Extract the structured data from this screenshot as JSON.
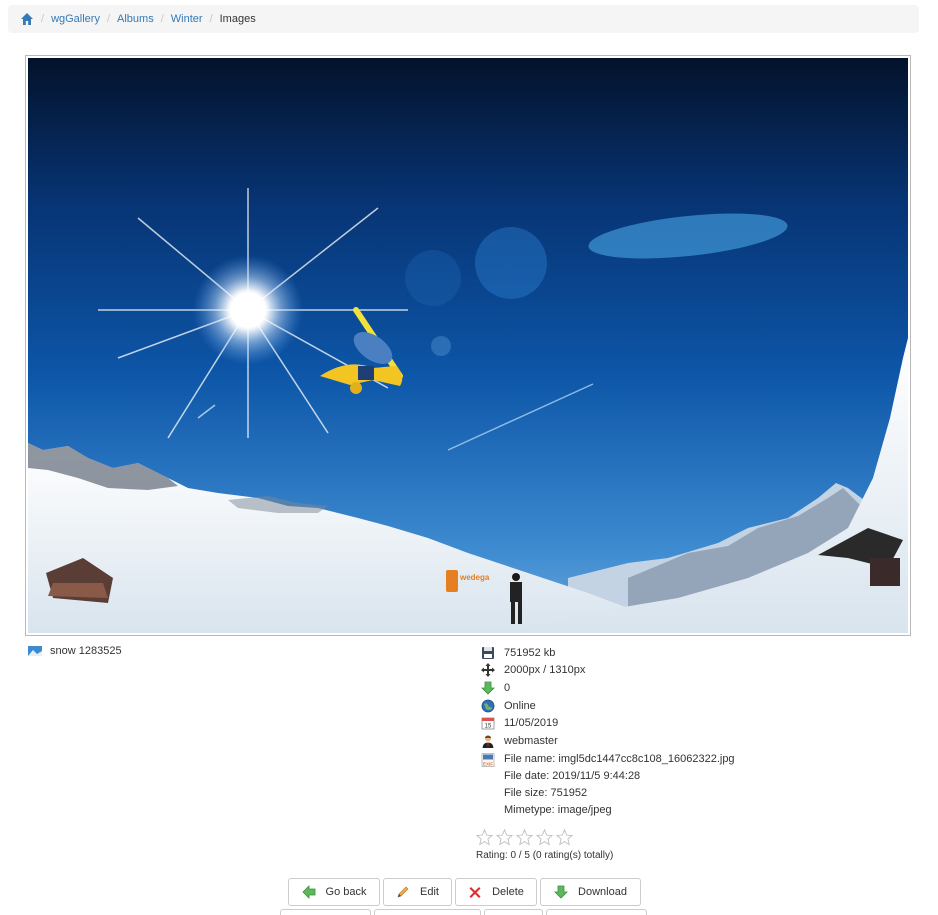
{
  "breadcrumb": {
    "items": [
      "wgGallery",
      "Albums",
      "Winter"
    ],
    "current": "Images"
  },
  "image": {
    "title": "snow 1283525",
    "logo_text": "wedega"
  },
  "info": {
    "file_size_kb": "751952 kb",
    "dimensions": "2000px / 1310px",
    "downloads": "0",
    "status": "Online",
    "date": "11/05/2019",
    "submitter": "webmaster",
    "exif": [
      "File name: imgl5dc1447cc8c108_16062322.jpg",
      "File date: 2019/11/5 9:44:28",
      "File size: 751952",
      "Mimetype: image/jpeg"
    ]
  },
  "rating": {
    "value": 0,
    "max": 5,
    "text": "Rating: 0 / 5 (0 rating(s) totally)"
  },
  "buttons": {
    "go_back": "Go back",
    "edit": "Edit",
    "delete": "Delete",
    "download": "Download"
  },
  "colors": {
    "link": "#337ab7",
    "sky_top": "#03122a",
    "sky_mid": "#0d56a8",
    "sky_horizon": "#3d8ad0"
  },
  "icons": {
    "home": "home-icon",
    "save": "floppy-disk-icon",
    "dimensions": "arrows-move-icon",
    "downloads": "green-down-arrow-icon",
    "status": "globe-icon",
    "date": "calendar-icon",
    "submitter": "user-icon",
    "exif": "exif-icon"
  }
}
